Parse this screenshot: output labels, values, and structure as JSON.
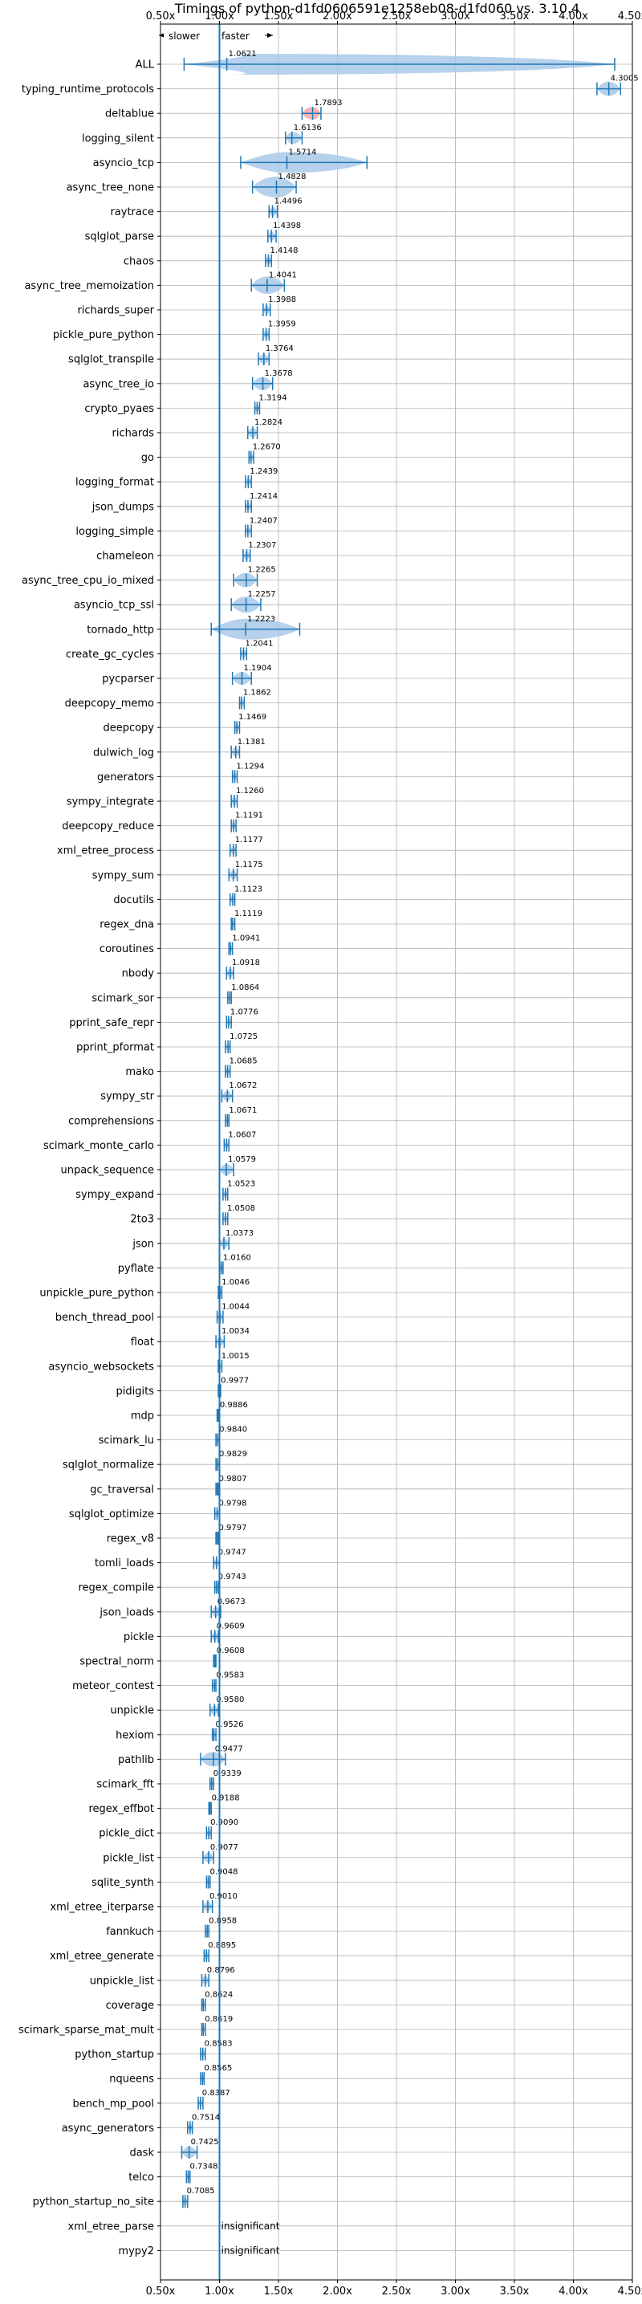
{
  "chart_data": {
    "type": "violin",
    "title": "Timings of python-d1fd0606591e1258eb08-d1fd060 vs. 3.10.4",
    "legend": {
      "slower": "slower",
      "faster": "faster"
    },
    "xlim": [
      0.5,
      4.5
    ],
    "x_ticks": [
      0.5,
      1.0,
      1.5,
      2.0,
      2.5,
      3.0,
      3.5,
      4.0,
      4.5
    ],
    "x_tick_labels": [
      "0.50x",
      "1.00x",
      "1.50x",
      "2.00x",
      "2.50x",
      "3.00x",
      "3.50x",
      "4.00x",
      "4.50x"
    ],
    "reference_line": 1.0,
    "colors": {
      "violin": "#a9c9e8",
      "marker": "#1f77b4",
      "highlight": "#f4a6a6"
    },
    "insignificant_label": "insignificant",
    "benchmarks": [
      {
        "name": "ALL",
        "value": 1.0621,
        "label": "1.0621",
        "min": 0.7,
        "max": 4.35
      },
      {
        "name": "typing_runtime_protocols",
        "value": 4.3005,
        "label": "4.3005",
        "min": 4.2,
        "max": 4.4
      },
      {
        "name": "deltablue",
        "value": 1.7893,
        "label": "1.7893",
        "min": 1.7,
        "max": 1.86
      },
      {
        "name": "logging_silent",
        "value": 1.6136,
        "label": "1.6136",
        "min": 1.56,
        "max": 1.7
      },
      {
        "name": "asyncio_tcp",
        "value": 1.5714,
        "label": "1.5714",
        "min": 1.18,
        "max": 2.25
      },
      {
        "name": "async_tree_none",
        "value": 1.4828,
        "label": "1.4828",
        "min": 1.28,
        "max": 1.65
      },
      {
        "name": "raytrace",
        "value": 1.4496,
        "label": "1.4496",
        "min": 1.42,
        "max": 1.49
      },
      {
        "name": "sqlglot_parse",
        "value": 1.4398,
        "label": "1.4398",
        "min": 1.41,
        "max": 1.48
      },
      {
        "name": "chaos",
        "value": 1.4148,
        "label": "1.4148",
        "min": 1.39,
        "max": 1.44
      },
      {
        "name": "async_tree_memoization",
        "value": 1.4041,
        "label": "1.4041",
        "min": 1.27,
        "max": 1.55
      },
      {
        "name": "richards_super",
        "value": 1.3988,
        "label": "1.3988",
        "min": 1.37,
        "max": 1.43
      },
      {
        "name": "pickle_pure_python",
        "value": 1.3959,
        "label": "1.3959",
        "min": 1.37,
        "max": 1.42
      },
      {
        "name": "sqlglot_transpile",
        "value": 1.3764,
        "label": "1.3764",
        "min": 1.33,
        "max": 1.42
      },
      {
        "name": "async_tree_io",
        "value": 1.3678,
        "label": "1.3678",
        "min": 1.28,
        "max": 1.45
      },
      {
        "name": "crypto_pyaes",
        "value": 1.3194,
        "label": "1.3194",
        "min": 1.3,
        "max": 1.34
      },
      {
        "name": "richards",
        "value": 1.2824,
        "label": "1.2824",
        "min": 1.24,
        "max": 1.32
      },
      {
        "name": "go",
        "value": 1.267,
        "label": "1.2670",
        "min": 1.25,
        "max": 1.29
      },
      {
        "name": "logging_format",
        "value": 1.2439,
        "label": "1.2439",
        "min": 1.22,
        "max": 1.27
      },
      {
        "name": "json_dumps",
        "value": 1.2414,
        "label": "1.2414",
        "min": 1.22,
        "max": 1.27
      },
      {
        "name": "logging_simple",
        "value": 1.2407,
        "label": "1.2407",
        "min": 1.22,
        "max": 1.27
      },
      {
        "name": "chameleon",
        "value": 1.2307,
        "label": "1.2307",
        "min": 1.2,
        "max": 1.26
      },
      {
        "name": "async_tree_cpu_io_mixed",
        "value": 1.2265,
        "label": "1.2265",
        "min": 1.12,
        "max": 1.32
      },
      {
        "name": "asyncio_tcp_ssl",
        "value": 1.2257,
        "label": "1.2257",
        "min": 1.1,
        "max": 1.35
      },
      {
        "name": "tornado_http",
        "value": 1.2223,
        "label": "1.2223",
        "min": 0.93,
        "max": 1.68
      },
      {
        "name": "create_gc_cycles",
        "value": 1.2041,
        "label": "1.2041",
        "min": 1.18,
        "max": 1.23
      },
      {
        "name": "pycparser",
        "value": 1.1904,
        "label": "1.1904",
        "min": 1.11,
        "max": 1.27
      },
      {
        "name": "deepcopy_memo",
        "value": 1.1862,
        "label": "1.1862",
        "min": 1.17,
        "max": 1.21
      },
      {
        "name": "deepcopy",
        "value": 1.1469,
        "label": "1.1469",
        "min": 1.13,
        "max": 1.17
      },
      {
        "name": "dulwich_log",
        "value": 1.1381,
        "label": "1.1381",
        "min": 1.1,
        "max": 1.17
      },
      {
        "name": "generators",
        "value": 1.1294,
        "label": "1.1294",
        "min": 1.11,
        "max": 1.15
      },
      {
        "name": "sympy_integrate",
        "value": 1.126,
        "label": "1.1260",
        "min": 1.1,
        "max": 1.15
      },
      {
        "name": "deepcopy_reduce",
        "value": 1.1191,
        "label": "1.1191",
        "min": 1.1,
        "max": 1.14
      },
      {
        "name": "xml_etree_process",
        "value": 1.1177,
        "label": "1.1177",
        "min": 1.09,
        "max": 1.14
      },
      {
        "name": "sympy_sum",
        "value": 1.1175,
        "label": "1.1175",
        "min": 1.08,
        "max": 1.15
      },
      {
        "name": "docutils",
        "value": 1.1123,
        "label": "1.1123",
        "min": 1.09,
        "max": 1.13
      },
      {
        "name": "regex_dna",
        "value": 1.1119,
        "label": "1.1119",
        "min": 1.1,
        "max": 1.13
      },
      {
        "name": "coroutines",
        "value": 1.0941,
        "label": "1.0941",
        "min": 1.08,
        "max": 1.11
      },
      {
        "name": "nbody",
        "value": 1.0918,
        "label": "1.0918",
        "min": 1.06,
        "max": 1.12
      },
      {
        "name": "scimark_sor",
        "value": 1.0864,
        "label": "1.0864",
        "min": 1.07,
        "max": 1.1
      },
      {
        "name": "pprint_safe_repr",
        "value": 1.0776,
        "label": "1.0776",
        "min": 1.06,
        "max": 1.1
      },
      {
        "name": "pprint_pformat",
        "value": 1.0725,
        "label": "1.0725",
        "min": 1.05,
        "max": 1.09
      },
      {
        "name": "mako",
        "value": 1.0685,
        "label": "1.0685",
        "min": 1.05,
        "max": 1.09
      },
      {
        "name": "sympy_str",
        "value": 1.0672,
        "label": "1.0672",
        "min": 1.02,
        "max": 1.11
      },
      {
        "name": "comprehensions",
        "value": 1.0671,
        "label": "1.0671",
        "min": 1.05,
        "max": 1.08
      },
      {
        "name": "scimark_monte_carlo",
        "value": 1.0607,
        "label": "1.0607",
        "min": 1.04,
        "max": 1.08
      },
      {
        "name": "unpack_sequence",
        "value": 1.0579,
        "label": "1.0579",
        "min": 1.0,
        "max": 1.12
      },
      {
        "name": "sympy_expand",
        "value": 1.0523,
        "label": "1.0523",
        "min": 1.03,
        "max": 1.07
      },
      {
        "name": "2to3",
        "value": 1.0508,
        "label": "1.0508",
        "min": 1.03,
        "max": 1.07
      },
      {
        "name": "json",
        "value": 1.0373,
        "label": "1.0373",
        "min": 1.0,
        "max": 1.08
      },
      {
        "name": "pyflate",
        "value": 1.016,
        "label": "1.0160",
        "min": 1.0,
        "max": 1.03
      },
      {
        "name": "unpickle_pure_python",
        "value": 1.0046,
        "label": "1.0046",
        "min": 0.99,
        "max": 1.02
      },
      {
        "name": "bench_thread_pool",
        "value": 1.0044,
        "label": "1.0044",
        "min": 0.98,
        "max": 1.03
      },
      {
        "name": "float",
        "value": 1.0034,
        "label": "1.0034",
        "min": 0.97,
        "max": 1.04
      },
      {
        "name": "asyncio_websockets",
        "value": 1.0015,
        "label": "1.0015",
        "min": 0.99,
        "max": 1.02
      },
      {
        "name": "pidigits",
        "value": 0.9977,
        "label": "0.9977",
        "min": 0.99,
        "max": 1.01
      },
      {
        "name": "mdp",
        "value": 0.9886,
        "label": "0.9886",
        "min": 0.98,
        "max": 1.0
      },
      {
        "name": "scimark_lu",
        "value": 0.984,
        "label": "0.9840",
        "min": 0.97,
        "max": 1.0
      },
      {
        "name": "sqlglot_normalize",
        "value": 0.9829,
        "label": "0.9829",
        "min": 0.97,
        "max": 1.0
      },
      {
        "name": "gc_traversal",
        "value": 0.9807,
        "label": "0.9807",
        "min": 0.97,
        "max": 0.99
      },
      {
        "name": "sqlglot_optimize",
        "value": 0.9798,
        "label": "0.9798",
        "min": 0.96,
        "max": 1.0
      },
      {
        "name": "regex_v8",
        "value": 0.9797,
        "label": "0.9797",
        "min": 0.97,
        "max": 0.99
      },
      {
        "name": "tomli_loads",
        "value": 0.9747,
        "label": "0.9747",
        "min": 0.95,
        "max": 1.0
      },
      {
        "name": "regex_compile",
        "value": 0.9743,
        "label": "0.9743",
        "min": 0.96,
        "max": 0.99
      },
      {
        "name": "json_loads",
        "value": 0.9673,
        "label": "0.9673",
        "min": 0.93,
        "max": 1.01
      },
      {
        "name": "pickle",
        "value": 0.9609,
        "label": "0.9609",
        "min": 0.93,
        "max": 0.99
      },
      {
        "name": "spectral_norm",
        "value": 0.9608,
        "label": "0.9608",
        "min": 0.95,
        "max": 0.97
      },
      {
        "name": "meteor_contest",
        "value": 0.9583,
        "label": "0.9583",
        "min": 0.94,
        "max": 0.97
      },
      {
        "name": "unpickle",
        "value": 0.958,
        "label": "0.9580",
        "min": 0.92,
        "max": 0.99
      },
      {
        "name": "hexiom",
        "value": 0.9526,
        "label": "0.9526",
        "min": 0.94,
        "max": 0.97
      },
      {
        "name": "pathlib",
        "value": 0.9477,
        "label": "0.9477",
        "min": 0.84,
        "max": 1.05
      },
      {
        "name": "scimark_fft",
        "value": 0.9339,
        "label": "0.9339",
        "min": 0.92,
        "max": 0.95
      },
      {
        "name": "regex_effbot",
        "value": 0.9188,
        "label": "0.9188",
        "min": 0.91,
        "max": 0.93
      },
      {
        "name": "pickle_dict",
        "value": 0.909,
        "label": "0.9090",
        "min": 0.89,
        "max": 0.93
      },
      {
        "name": "pickle_list",
        "value": 0.9077,
        "label": "0.9077",
        "min": 0.86,
        "max": 0.95
      },
      {
        "name": "sqlite_synth",
        "value": 0.9048,
        "label": "0.9048",
        "min": 0.89,
        "max": 0.92
      },
      {
        "name": "xml_etree_iterparse",
        "value": 0.901,
        "label": "0.9010",
        "min": 0.86,
        "max": 0.94
      },
      {
        "name": "fannkuch",
        "value": 0.8958,
        "label": "0.8958",
        "min": 0.88,
        "max": 0.91
      },
      {
        "name": "xml_etree_generate",
        "value": 0.8895,
        "label": "0.8895",
        "min": 0.87,
        "max": 0.91
      },
      {
        "name": "unpickle_list",
        "value": 0.8796,
        "label": "0.8796",
        "min": 0.85,
        "max": 0.91
      },
      {
        "name": "coverage",
        "value": 0.8624,
        "label": "0.8624",
        "min": 0.85,
        "max": 0.88
      },
      {
        "name": "scimark_sparse_mat_mult",
        "value": 0.8619,
        "label": "0.8619",
        "min": 0.85,
        "max": 0.88
      },
      {
        "name": "python_startup",
        "value": 0.8583,
        "label": "0.8583",
        "min": 0.84,
        "max": 0.88
      },
      {
        "name": "nqueens",
        "value": 0.8565,
        "label": "0.8565",
        "min": 0.84,
        "max": 0.87
      },
      {
        "name": "bench_mp_pool",
        "value": 0.8387,
        "label": "0.8387",
        "min": 0.82,
        "max": 0.86
      },
      {
        "name": "async_generators",
        "value": 0.7514,
        "label": "0.7514",
        "min": 0.73,
        "max": 0.77
      },
      {
        "name": "dask",
        "value": 0.7425,
        "label": "0.7425",
        "min": 0.68,
        "max": 0.81
      },
      {
        "name": "telco",
        "value": 0.7348,
        "label": "0.7348",
        "min": 0.72,
        "max": 0.75
      },
      {
        "name": "python_startup_no_site",
        "value": 0.7085,
        "label": "0.7085",
        "min": 0.69,
        "max": 0.73
      },
      {
        "name": "xml_etree_parse",
        "value": null,
        "label": "insignificant",
        "min": null,
        "max": null
      },
      {
        "name": "mypy2",
        "value": null,
        "label": "insignificant",
        "min": null,
        "max": null
      }
    ]
  }
}
